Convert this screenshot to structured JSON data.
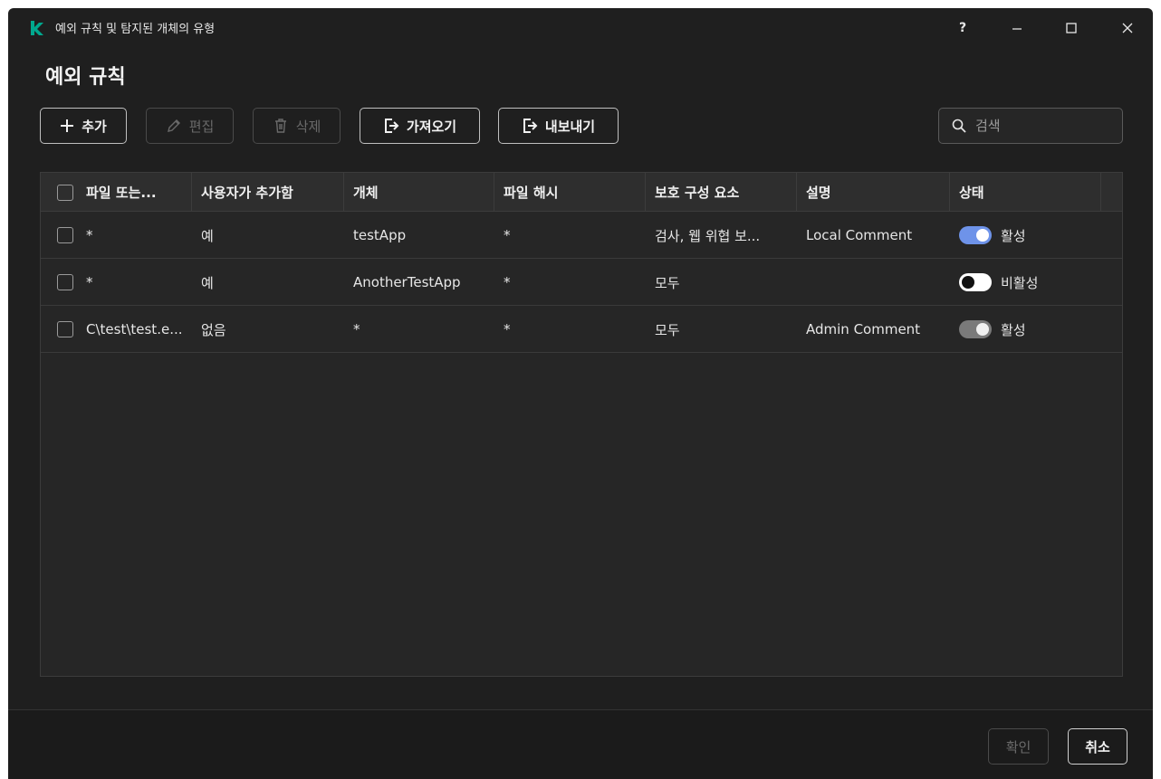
{
  "window": {
    "title": "예외 규칙 및 탐지된 개체의 유형",
    "help_label": "?",
    "min_label": "–",
    "max_label": "☐",
    "close_label": "✕"
  },
  "page": {
    "title": "예외 규칙"
  },
  "toolbar": {
    "add_label": "추가",
    "edit_label": "편집",
    "delete_label": "삭제",
    "import_label": "가져오기",
    "export_label": "내보내기"
  },
  "search": {
    "placeholder": "검색"
  },
  "table": {
    "columns": [
      "파일 또는...",
      "사용자가 추가함",
      "개체",
      "파일 해시",
      "보호 구성 요소",
      "설명",
      "상태"
    ],
    "rows": [
      {
        "file": "*",
        "added_by_user": "예",
        "object": "testApp",
        "hash": "*",
        "component": "검사, 웹 위협 보...",
        "description": "Local Comment",
        "status": "활성",
        "toggle": "on"
      },
      {
        "file": "*",
        "added_by_user": "예",
        "object": "AnotherTestApp",
        "hash": "*",
        "component": "모두",
        "description": "",
        "status": "비활성",
        "toggle": "off"
      },
      {
        "file": "C\\test\\test.e...",
        "added_by_user": "없음",
        "object": "*",
        "hash": "*",
        "component": "모두",
        "description": "Admin Comment",
        "status": "활성",
        "toggle": "locked"
      }
    ]
  },
  "footer": {
    "ok_label": "확인",
    "cancel_label": "취소"
  },
  "colors": {
    "accent": "#6e93e9",
    "logo": "#00a88e",
    "background": "#1f1f1f"
  }
}
